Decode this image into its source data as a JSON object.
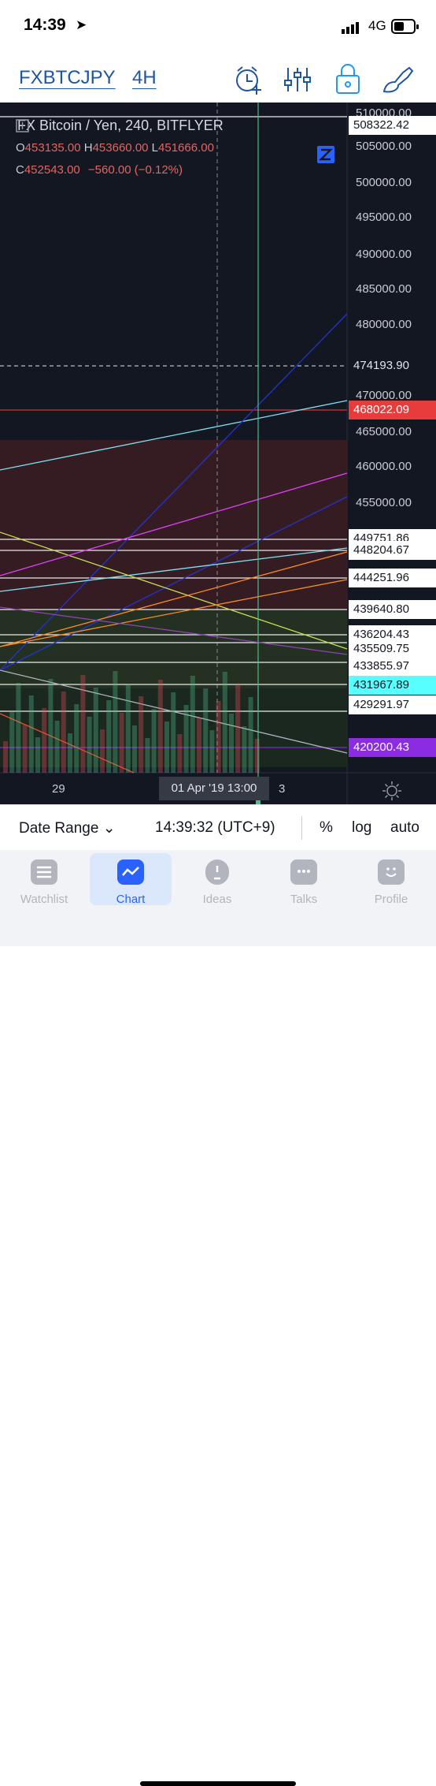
{
  "status_bar": {
    "time": "14:39",
    "network": "4G"
  },
  "header": {
    "symbol": "FXBTCJPY",
    "timeframe": "4H",
    "icons": [
      "alarm-add-icon",
      "indicators-icon",
      "lock-icon",
      "drawing-brush-icon"
    ]
  },
  "chart": {
    "title": "FX Bitcoin / Yen, 240, BITFLYER",
    "ohlc": {
      "o_label": "O",
      "o": "453135.00",
      "h_label": "H",
      "h": "453660.00",
      "l_label": "L",
      "l": "451666.00",
      "c_label": "C",
      "c": "452543.00",
      "change": "−560.00 (−0.12%)"
    },
    "y_ticks": [
      "510000.00",
      "505000.00",
      "500000.00",
      "495000.00",
      "490000.00",
      "485000.00",
      "480000.00",
      "470000.00",
      "465000.00",
      "460000.00",
      "455000.00"
    ],
    "price_tags": [
      {
        "value": "508322.42",
        "style": "white"
      },
      {
        "value": "474193.90",
        "style": "dark"
      },
      {
        "value": "468022.09",
        "style": "red"
      },
      {
        "value": "449751.86",
        "style": "white"
      },
      {
        "value": "448204.67",
        "style": "white"
      },
      {
        "value": "444251.96",
        "style": "white"
      },
      {
        "value": "439640.80",
        "style": "white"
      },
      {
        "value": "436204.43",
        "style": "white"
      },
      {
        "value": "435509.75",
        "style": "white"
      },
      {
        "value": "433855.97",
        "style": "white"
      },
      {
        "value": "431967.89",
        "style": "cyan"
      },
      {
        "value": "429291.97",
        "style": "white"
      },
      {
        "value": "420200.43",
        "style": "purple"
      }
    ],
    "x_labels": {
      "left": "29",
      "cursor": "01 Apr '19   13:00",
      "right": "3"
    },
    "colors": {
      "up": "#53b987",
      "down": "#eb4d5c",
      "bg": "#131722"
    }
  },
  "toolbar": {
    "date_range": "Date Range",
    "clock": "14:39:32 (UTC+9)",
    "percent": "%",
    "log": "log",
    "auto": "auto"
  },
  "tabs": [
    {
      "label": "Watchlist",
      "icon": "watchlist-icon",
      "active": false
    },
    {
      "label": "Chart",
      "icon": "chart-icon",
      "active": true
    },
    {
      "label": "Ideas",
      "icon": "ideas-icon",
      "active": false
    },
    {
      "label": "Talks",
      "icon": "talks-icon",
      "active": false
    },
    {
      "label": "Profile",
      "icon": "profile-icon",
      "active": false
    }
  ]
}
